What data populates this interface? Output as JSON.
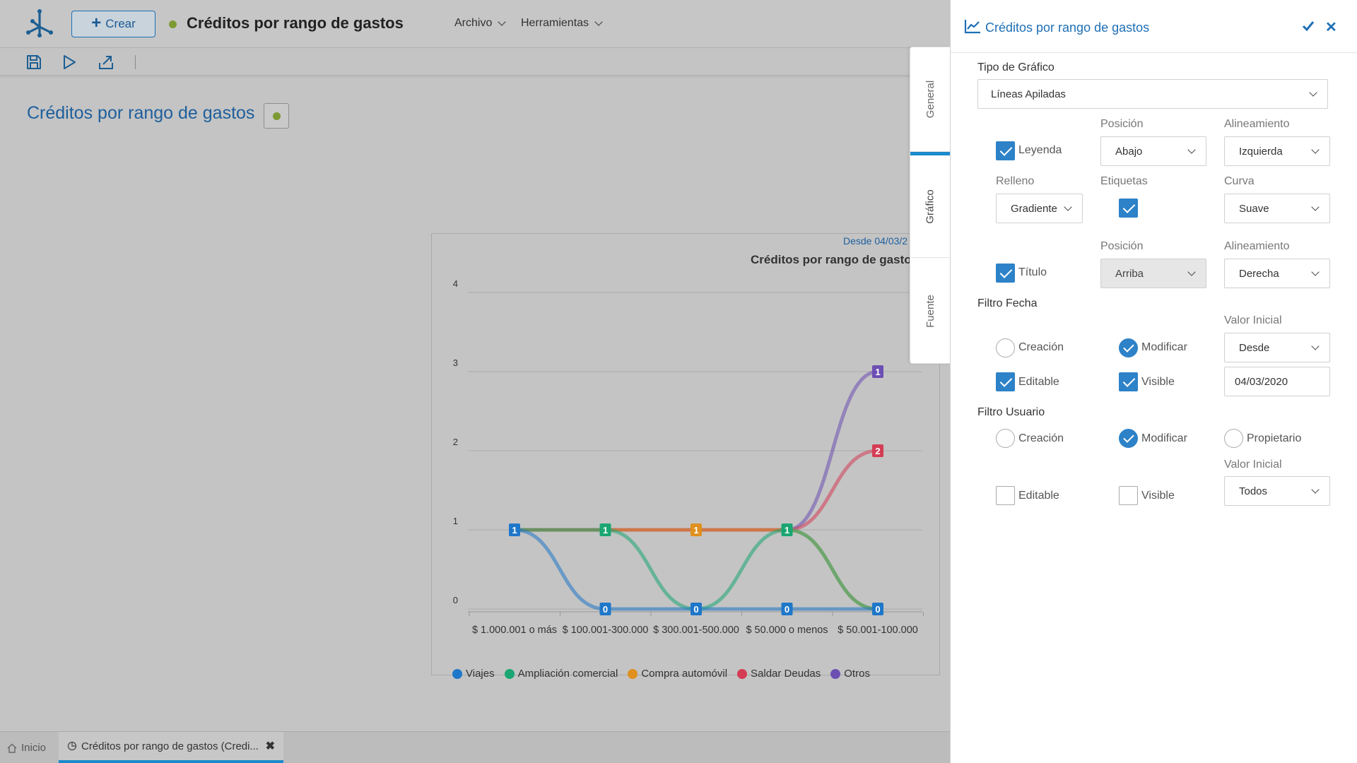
{
  "header": {
    "create_label": "Crear",
    "title": "Créditos por rango de gastos",
    "menus": [
      "Archivo",
      "Herramientas"
    ]
  },
  "toolbar": {
    "icons": [
      "save-icon",
      "play-icon",
      "export-icon"
    ]
  },
  "report": {
    "title": "Créditos por rango de gastos"
  },
  "chart": {
    "date_label": "Desde 04/03/2",
    "title": "Créditos por rango de gastos"
  },
  "chart_data": {
    "type": "line",
    "stacked": true,
    "curve": "smooth",
    "title": "Créditos por rango de gastos",
    "categories": [
      "$ 1.000.001 o más",
      "$ 100.001-300.000",
      "$ 300.001-500.000",
      "$ 50.000 o menos",
      "$ 50.001-100.000"
    ],
    "ylim": [
      0,
      4
    ],
    "yticks": [
      0,
      1,
      2,
      3,
      4
    ],
    "grid": true,
    "legend_position": "bottom-left",
    "series": [
      {
        "name": "Viajes",
        "color": "#1f77c9",
        "values": [
          1,
          0,
          0,
          0,
          0
        ]
      },
      {
        "name": "Ampliación comercial",
        "color": "#1aa673",
        "values": [
          0,
          1,
          0,
          1,
          0
        ]
      },
      {
        "name": "Compra automóvil",
        "color": "#e0901e",
        "values": [
          0,
          0,
          1,
          0,
          0
        ]
      },
      {
        "name": "Saldar Deudas",
        "color": "#d43d55",
        "values": [
          0,
          0,
          0,
          0,
          2
        ]
      },
      {
        "name": "Otros",
        "color": "#6c4fb3",
        "values": [
          0,
          0,
          0,
          0,
          1
        ]
      }
    ],
    "point_labels": [
      {
        "x": 0,
        "y": 1,
        "text": "1",
        "color": "#1f77c9"
      },
      {
        "x": 1,
        "y": 1,
        "text": "1",
        "color": "#1aa673"
      },
      {
        "x": 1,
        "y": 0,
        "text": "0",
        "color": "#1f77c9"
      },
      {
        "x": 2,
        "y": 1,
        "text": "1",
        "color": "#e0901e"
      },
      {
        "x": 2,
        "y": 0,
        "text": "0",
        "color": "#1f77c9"
      },
      {
        "x": 3,
        "y": 1,
        "text": "1",
        "color": "#1aa673"
      },
      {
        "x": 3,
        "y": 0,
        "text": "0",
        "color": "#1f77c9"
      },
      {
        "x": 4,
        "y": 3,
        "text": "1",
        "color": "#6c4fb3"
      },
      {
        "x": 4,
        "y": 2,
        "text": "2",
        "color": "#d43d55"
      },
      {
        "x": 4,
        "y": 0,
        "text": "0",
        "color": "#1f77c9"
      }
    ]
  },
  "bottom_tabs": {
    "home": "Inicio",
    "active": "Créditos por rango de gastos (Credi..."
  },
  "panel": {
    "title": "Créditos por rango de gastos",
    "tabs": [
      "General",
      "Gráfico",
      "Fuente"
    ],
    "chart_type_label": "Tipo de Gráfico",
    "chart_type_value": "Líneas Apiladas",
    "legend": {
      "label": "Leyenda",
      "checked": true,
      "position_label": "Posición",
      "position_value": "Abajo",
      "align_label": "Alineamiento",
      "align_value": "Izquierda"
    },
    "fill": {
      "label": "Relleno",
      "value": "Gradiente",
      "labels_label": "Etiquetas",
      "labels_checked": true,
      "curve_label": "Curva",
      "curve_value": "Suave"
    },
    "title_opt": {
      "label": "Título",
      "checked": true,
      "position_label": "Posición",
      "position_value": "Arriba",
      "align_label": "Alineamiento",
      "align_value": "Derecha"
    },
    "date_filter": {
      "label": "Filtro Fecha",
      "creation": "Creación",
      "modify": "Modificar",
      "initial_label": "Valor Inicial",
      "initial_value": "Desde",
      "editable": "Editable",
      "visible": "Visible",
      "date_value": "04/03/2020"
    },
    "user_filter": {
      "label": "Filtro Usuario",
      "creation": "Creación",
      "modify": "Modificar",
      "owner": "Propietario",
      "initial_label": "Valor Inicial",
      "initial_value": "Todos",
      "editable": "Editable",
      "visible": "Visible"
    }
  }
}
